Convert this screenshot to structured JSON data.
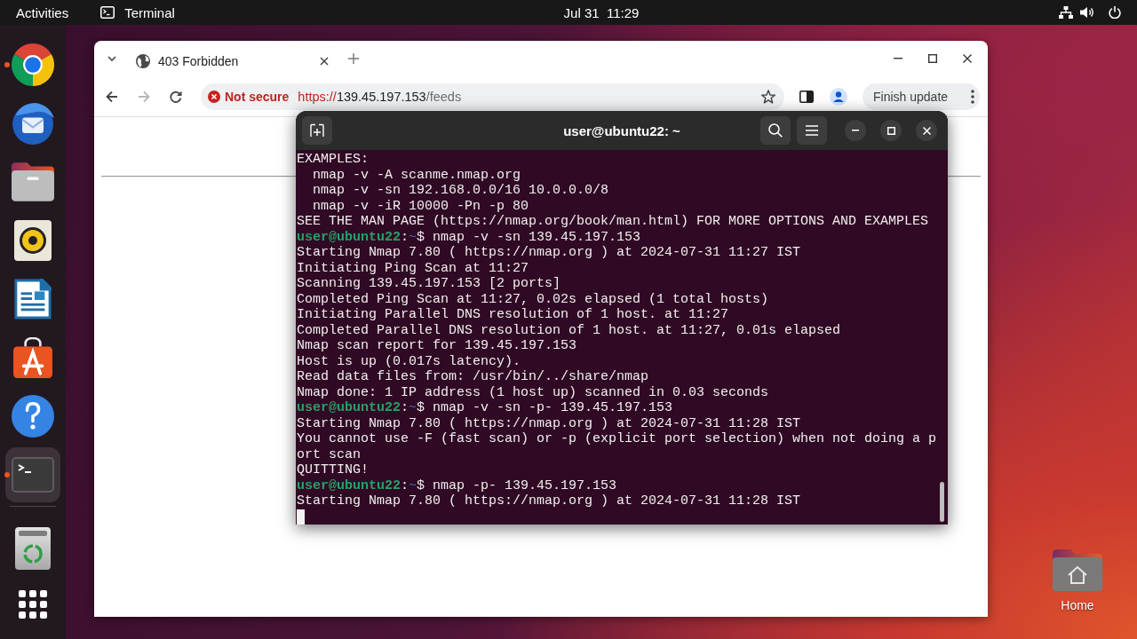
{
  "top_bar": {
    "activities": "Activities",
    "app_name": "Terminal",
    "clock": "Jul 31  11:29"
  },
  "dock": {
    "items": [
      {
        "kind": "browser",
        "running": true,
        "selected": false
      },
      {
        "kind": "mail",
        "running": false,
        "selected": false
      },
      {
        "kind": "files",
        "running": false,
        "selected": false
      },
      {
        "kind": "music",
        "running": false,
        "selected": false
      },
      {
        "kind": "writer",
        "running": false,
        "selected": false
      },
      {
        "kind": "store",
        "running": false,
        "selected": false
      },
      {
        "kind": "help",
        "running": false,
        "selected": false
      },
      {
        "kind": "terminal",
        "running": true,
        "selected": true
      }
    ],
    "bottom_items": [
      {
        "kind": "trash"
      },
      {
        "kind": "apps"
      }
    ]
  },
  "browser": {
    "tabs": [
      {
        "title": "403 Forbidden",
        "selected": true
      }
    ],
    "nav": {
      "back_disabled": false,
      "forward_disabled": true
    },
    "security_label": "Not secure",
    "url": {
      "scheme": "https://",
      "host": "139.45.197.153",
      "path": "/feeds"
    },
    "update_button": "Finish update"
  },
  "terminal": {
    "title": "user@ubuntu22: ~",
    "lines": [
      {
        "kind": "output",
        "text": "EXAMPLES:"
      },
      {
        "kind": "output",
        "text": "  nmap -v -A scanme.nmap.org"
      },
      {
        "kind": "output",
        "text": "  nmap -v -sn 192.168.0.0/16 10.0.0.0/8"
      },
      {
        "kind": "output",
        "text": "  nmap -v -iR 10000 -Pn -p 80"
      },
      {
        "kind": "output",
        "text": "SEE THE MAN PAGE (https://nmap.org/book/man.html) FOR MORE OPTIONS AND EXAMPLES"
      },
      {
        "kind": "prompt",
        "user": "user@ubuntu22",
        "separator": ":",
        "path": "~",
        "command": "$ nmap -v -sn 139.45.197.153"
      },
      {
        "kind": "output",
        "text": "Starting Nmap 7.80 ( https://nmap.org ) at 2024-07-31 11:27 IST"
      },
      {
        "kind": "output",
        "text": "Initiating Ping Scan at 11:27"
      },
      {
        "kind": "output",
        "text": "Scanning 139.45.197.153 [2 ports]"
      },
      {
        "kind": "output",
        "text": "Completed Ping Scan at 11:27, 0.02s elapsed (1 total hosts)"
      },
      {
        "kind": "output",
        "text": "Initiating Parallel DNS resolution of 1 host. at 11:27"
      },
      {
        "kind": "output",
        "text": "Completed Parallel DNS resolution of 1 host. at 11:27, 0.01s elapsed"
      },
      {
        "kind": "output",
        "text": "Nmap scan report for 139.45.197.153"
      },
      {
        "kind": "output",
        "text": "Host is up (0.017s latency)."
      },
      {
        "kind": "output",
        "text": "Read data files from: /usr/bin/../share/nmap"
      },
      {
        "kind": "output",
        "text": "Nmap done: 1 IP address (1 host up) scanned in 0.03 seconds"
      },
      {
        "kind": "prompt",
        "user": "user@ubuntu22",
        "separator": ":",
        "path": "~",
        "command": "$ nmap -v -sn -p- 139.45.197.153"
      },
      {
        "kind": "output",
        "text": "Starting Nmap 7.80 ( https://nmap.org ) at 2024-07-31 11:28 IST"
      },
      {
        "kind": "output",
        "text": "You cannot use -F (fast scan) or -p (explicit port selection) when not doing a p"
      },
      {
        "kind": "output",
        "text": "ort scan"
      },
      {
        "kind": "output",
        "text": "QUITTING!"
      },
      {
        "kind": "prompt",
        "user": "user@ubuntu22",
        "separator": ":",
        "path": "~",
        "command": "$ nmap -p- 139.45.197.153"
      },
      {
        "kind": "output",
        "text": "Starting Nmap 7.80 ( https://nmap.org ) at 2024-07-31 11:28 IST"
      }
    ],
    "cursor": true
  },
  "desktop": {
    "icons": [
      {
        "kind": "home",
        "label": "Home"
      }
    ]
  }
}
